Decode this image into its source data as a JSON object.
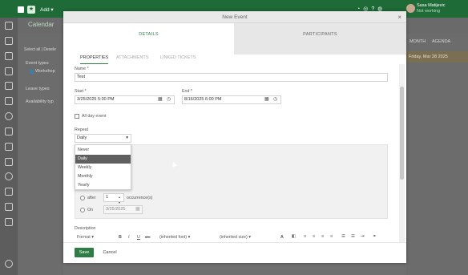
{
  "app": {
    "add_label": "Add",
    "calendar_title": "Calendar"
  },
  "user": {
    "name": "Sasa Matijevic",
    "status": "Not working"
  },
  "background": {
    "select_all": "Select all",
    "deselect": "Desele",
    "event_types": "Event types",
    "workshop": "Workshop",
    "leave_types": "Leave types",
    "availability": "Availability typ",
    "view_month": "MONTH",
    "view_agenda": "AGENDA",
    "date_header": "Friday, Mar 28 2025"
  },
  "modal": {
    "title": "New Event",
    "close": "×",
    "tabs": [
      "DETAILS",
      "PARTICIPANTS"
    ],
    "subtabs": [
      "PROPERTIES",
      "ATTACHMENTS",
      "LINKED TICKETS"
    ],
    "name_label": "Name *",
    "name_value": "Test",
    "start_label": "Start *",
    "start_value": "3/25/2025 5:00 PM",
    "end_label": "End *",
    "end_value": "8/16/2025 6:00 PM",
    "all_day_label": "All day event",
    "repeat_label": "Repeat",
    "repeat_value": "Daily",
    "repeat_options": [
      "Never",
      "Daily",
      "Weekly",
      "Monthly",
      "Yearly"
    ],
    "after_label": "after",
    "occurrences_value": "1",
    "occurrences_label": "occurrence(s)",
    "on_label": "On",
    "on_date": "3/25/2025",
    "description_label": "Description",
    "toolbar": {
      "format": "Format",
      "bold": "B",
      "italic": "I",
      "underline": "U",
      "strike": "abc",
      "font": "(inherited font)",
      "size": "(inherited size)",
      "font_color": "A"
    },
    "save_label": "Save",
    "cancel_label": "Cancel"
  },
  "colors": {
    "brand": "#1e6b37",
    "accent": "#2f7d46",
    "selected_option": "#5f5f5f"
  }
}
